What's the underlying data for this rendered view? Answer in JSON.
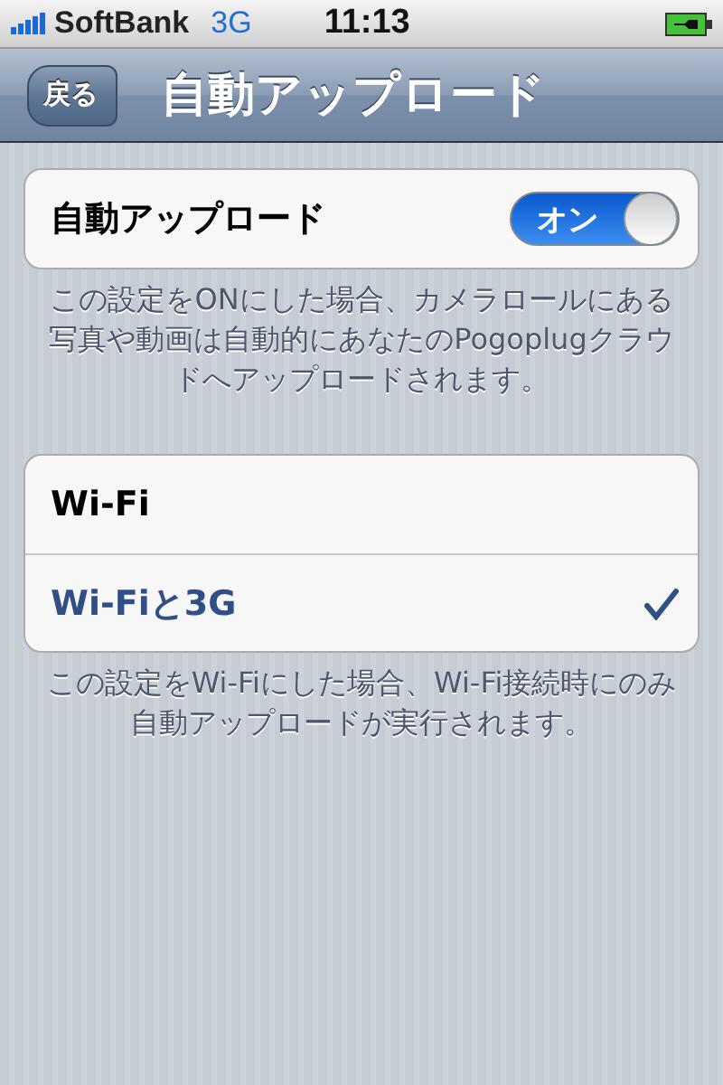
{
  "status_bar": {
    "carrier": "SoftBank",
    "network": "3G",
    "time": "11:13"
  },
  "nav_bar": {
    "back_button": "戻る",
    "title": "自動アップロード"
  },
  "auto_upload": {
    "label": "自動アップロード",
    "on": true,
    "switch_label": "オン"
  },
  "auto_upload_footer": "この設定をONにした場合、カメラロールにある写真や動画は自動的にあなたのPogoplugクラウドへアップロードされます。",
  "network_options": [
    {
      "label": "Wi-Fi",
      "selected": false
    },
    {
      "label": "Wi-Fiと3G",
      "selected": true
    }
  ],
  "network_footer": "この設定をWi-Fiにした場合、Wi-Fi接続時にのみ自動アップロードが実行されます。"
}
